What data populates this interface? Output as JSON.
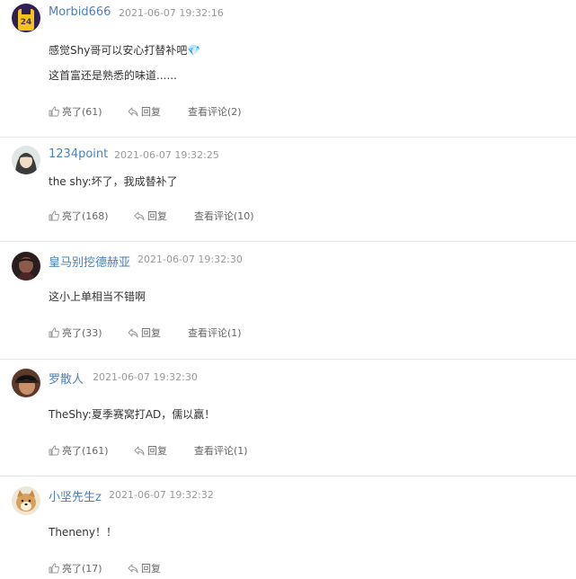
{
  "comments": [
    {
      "user": "Morbid666",
      "time": "2021-06-07 19:32:16",
      "lines": [
        "感觉Shy哥可以安心打替补吧💎",
        "这首富还是熟悉的味道......"
      ],
      "like_label": "亮了",
      "like_count": "(61)",
      "reply_label": "回复",
      "view_label": "查看评论",
      "view_count": "(2)",
      "avatar_icon": "lakers-jersey-avatar"
    },
    {
      "user": "1234point",
      "time": "2021-06-07 19:32:25",
      "lines": [
        "the shy:坏了，我成替补了"
      ],
      "like_label": "亮了",
      "like_count": "(168)",
      "reply_label": "回复",
      "view_label": "查看评论",
      "view_count": "(10)",
      "avatar_icon": "anime-girl-avatar"
    },
    {
      "user": "皇马别挖德赫亚",
      "time": "2021-06-07 19:32:30",
      "lines": [
        "这小上单相当不错啊"
      ],
      "like_label": "亮了",
      "like_count": "(33)",
      "reply_label": "回复",
      "view_label": "查看评论",
      "view_count": "(1)",
      "avatar_icon": "dark-portrait-avatar"
    },
    {
      "user": "罗散人",
      "time": "2021-06-07 19:32:30",
      "lines": [
        "TheShy:夏季赛窝打AD，儒以赢！"
      ],
      "like_label": "亮了",
      "like_count": "(161)",
      "reply_label": "回复",
      "view_label": "查看评论",
      "view_count": "(1)",
      "avatar_icon": "cap-man-avatar"
    },
    {
      "user": "小坚先生z",
      "time": "2021-06-07 19:32:32",
      "lines": [
        "Theneny！！"
      ],
      "like_label": "亮了",
      "like_count": "(17)",
      "reply_label": "回复",
      "view_label": "",
      "view_count": "",
      "avatar_icon": "shiba-dog-avatar"
    }
  ],
  "colors": {
    "username": "#4e7fb8",
    "time": "#999999",
    "text": "#333333",
    "action": "#666666",
    "divider": "#e6e6e6"
  }
}
